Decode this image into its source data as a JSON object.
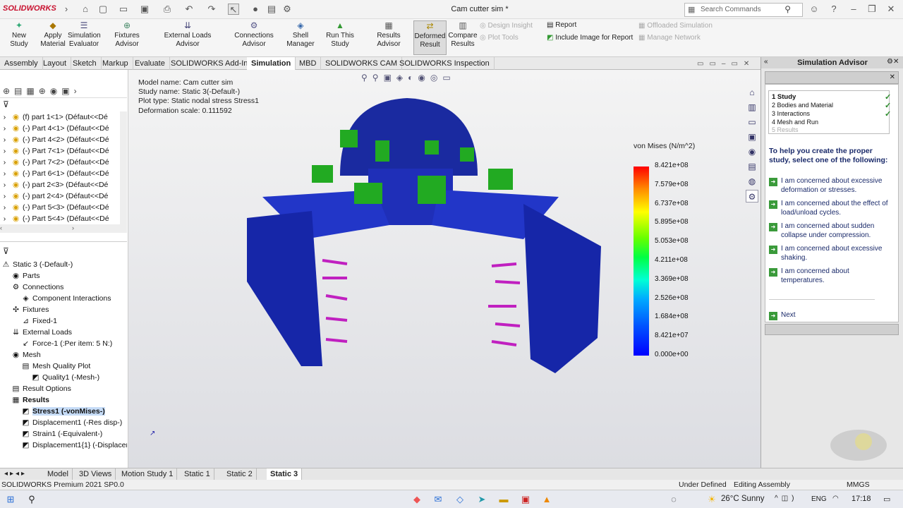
{
  "title_bar": {
    "logo": "SOLIDWORKS",
    "document_title": "Cam cutter sim *",
    "search_placeholder": "Search Commands"
  },
  "ribbon": {
    "buttons": [
      {
        "label": "New Study",
        "icon": "new-study-icon"
      },
      {
        "label": "Apply\nMaterial",
        "icon": "material-icon"
      },
      {
        "label": "Simulation\nEvaluator",
        "icon": "evaluator-icon"
      },
      {
        "label": "Fixtures Advisor",
        "icon": "fixture-icon"
      },
      {
        "label": "External Loads Advisor",
        "icon": "loads-icon"
      },
      {
        "label": "Connections Advisor",
        "icon": "connections-icon"
      },
      {
        "label": "Shell\nManager",
        "icon": "shell-icon"
      },
      {
        "label": "Run This Study",
        "icon": "run-icon"
      },
      {
        "label": "Results Advisor",
        "icon": "results-icon"
      },
      {
        "label": "Deformed\nResult",
        "icon": "deformed-icon"
      },
      {
        "label": "Compare\nResults",
        "icon": "compare-icon"
      }
    ],
    "small": {
      "design_insight": "Design Insight",
      "plot_tools": "Plot Tools",
      "report": "Report",
      "include_image": "Include Image for Report",
      "offloaded": "Offloaded Simulation",
      "manage_network": "Manage Network"
    }
  },
  "cm_tabs": [
    "Assembly",
    "Layout",
    "Sketch",
    "Markup",
    "Evaluate",
    "SOLIDWORKS Add-Ins",
    "Simulation",
    "MBD",
    "SOLIDWORKS CAM",
    "SOLIDWORKS Inspection"
  ],
  "feature_tree": [
    "(f) part 1<1> (Défaut<<Dé",
    "(-) Part 4<1> (Défaut<<Dé",
    "(-) Part 4<2> (Défaut<<Dé",
    "(-) Part 7<1> (Défaut<<Dé",
    "(-) Part 7<2> (Défaut<<Dé",
    "(-) Part 6<1> (Défaut<<Dé",
    "(-) part 2<3> (Défaut<<Dé",
    "(-) part 2<4> (Défaut<<Dé",
    "(-) Part 5<3> (Défaut<<Dé",
    "(-) Part 5<4> (Défaut<<Dé"
  ],
  "sim_tree": [
    {
      "label": "Static 3 (-Default-)",
      "indent": 0,
      "icon": "warning-icon"
    },
    {
      "label": "Parts",
      "indent": 1,
      "icon": "parts-icon"
    },
    {
      "label": "Connections",
      "indent": 1,
      "icon": "connections-icon"
    },
    {
      "label": "Component Interactions",
      "indent": 2,
      "icon": "interaction-icon"
    },
    {
      "label": "Fixtures",
      "indent": 1,
      "icon": "fixtures-icon"
    },
    {
      "label": "Fixed-1",
      "indent": 2,
      "icon": "fixed-icon"
    },
    {
      "label": "External Loads",
      "indent": 1,
      "icon": "loads-icon"
    },
    {
      "label": "Force-1 (:Per item: 5 N:)",
      "indent": 2,
      "icon": "force-icon"
    },
    {
      "label": "Mesh",
      "indent": 1,
      "icon": "mesh-icon"
    },
    {
      "label": "Mesh Quality Plot",
      "indent": 2,
      "icon": "plot-icon"
    },
    {
      "label": "Quality1 (-Mesh-)",
      "indent": 3,
      "icon": "quality-icon"
    },
    {
      "label": "Result Options",
      "indent": 1,
      "icon": "options-icon"
    },
    {
      "label": "Results",
      "indent": 1,
      "icon": "results-icon"
    },
    {
      "label": "Stress1 (-vonMises-)",
      "indent": 2,
      "icon": "stress-icon"
    },
    {
      "label": "Displacement1 (-Res disp-)",
      "indent": 2,
      "icon": "disp-icon"
    },
    {
      "label": "Strain1 (-Equivalent-)",
      "indent": 2,
      "icon": "strain-icon"
    },
    {
      "label": "Displacement1{1} (-Displacem",
      "indent": 2,
      "icon": "disp-icon"
    }
  ],
  "viewport_info": {
    "model": "Model name: Cam cutter sim",
    "study": "Study name: Static 3(-Default-)",
    "plot_type": "Plot type: Static nodal stress Stress1",
    "scale": "Deformation scale: 0.111592"
  },
  "legend": {
    "title": "von Mises (N/m^2)",
    "ticks": [
      "8.421e+08",
      "7.579e+08",
      "6.737e+08",
      "5.895e+08",
      "5.053e+08",
      "4.211e+08",
      "3.369e+08",
      "2.526e+08",
      "1.684e+08",
      "8.421e+07",
      "0.000e+00"
    ]
  },
  "advisor": {
    "title": "Simulation Advisor",
    "steps": [
      {
        "label": "1  Study",
        "done": true
      },
      {
        "label": "2  Bodies and Material",
        "done": true
      },
      {
        "label": "3  Interactions",
        "done": true
      },
      {
        "label": "4  Mesh and Run",
        "done": true
      },
      {
        "label": "5  Results",
        "done": false
      }
    ],
    "help": "To help you create the proper study, select one of the following:",
    "options": [
      "I am concerned about excessive deformation or stresses.",
      "I am concerned about the effect of load/unload cycles.",
      "I am concerned about sudden collapse under compression.",
      "I am concerned about excessive shaking.",
      "I am concerned about temperatures."
    ],
    "next": "Next"
  },
  "bottom_tabs": [
    "Model",
    "3D Views",
    "Motion Study 1",
    "Static 1",
    "Static 2",
    "Static 3"
  ],
  "status": {
    "product": "SOLIDWORKS Premium 2021 SP0.0",
    "state": "Under Defined",
    "mode": "Editing Assembly",
    "units": "MMGS"
  },
  "taskbar": {
    "weather": "26°C  Sunny",
    "lang": "ENG",
    "time": "17:18"
  }
}
